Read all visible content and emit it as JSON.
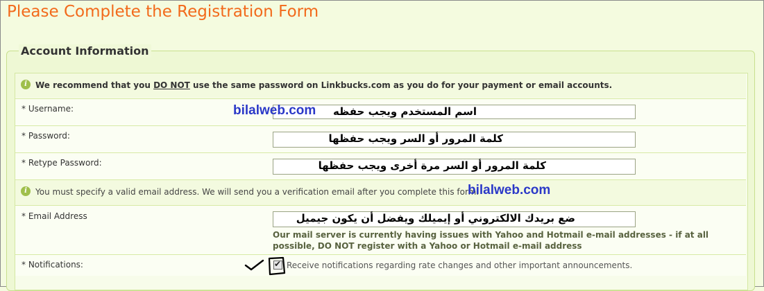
{
  "page": {
    "title": "Please Complete the Registration Form"
  },
  "section": {
    "legend": "Account Information"
  },
  "password_notice": {
    "prefix": "We recommend that you ",
    "emphasis": "DO NOT",
    "suffix": " use the same password on Linkbucks.com as you do for your payment or email accounts."
  },
  "username": {
    "label": "* Username:",
    "value": "اسم المستخدم ويجب حفظه"
  },
  "password": {
    "label": "* Password:",
    "value": "كلمة المرور أو السر ويجب حفظها"
  },
  "retype_password": {
    "label": "* Retype Password:",
    "value": "كلمة المرور أو السر مرة أخرى ويجب حفظها"
  },
  "email_notice": {
    "text": "You must specify a valid email address. We will send you a verification email after you complete this form."
  },
  "email": {
    "label": "* Email Address",
    "value": "ضع بريدك الالكتروني أو إيميلك ويفضل أن يكون جيميل",
    "note": "Our mail server is currently having issues with Yahoo and Hotmail e-mail addresses - if at all possible, DO NOT register with a Yahoo or Hotmail e-mail address"
  },
  "notifications": {
    "label": "* Notifications:",
    "checkbox_label": "Receive notifications regarding rate changes and other important announcements.",
    "checked": true
  },
  "watermarks": {
    "first": "bilalweb.com",
    "second": "bilalweb.com"
  },
  "icons": {
    "info": "info-icon",
    "check": "checkmark-icon"
  },
  "colors": {
    "title": "#f26a1b",
    "watermark": "#2b38c8",
    "panel": "#eef8d4"
  }
}
